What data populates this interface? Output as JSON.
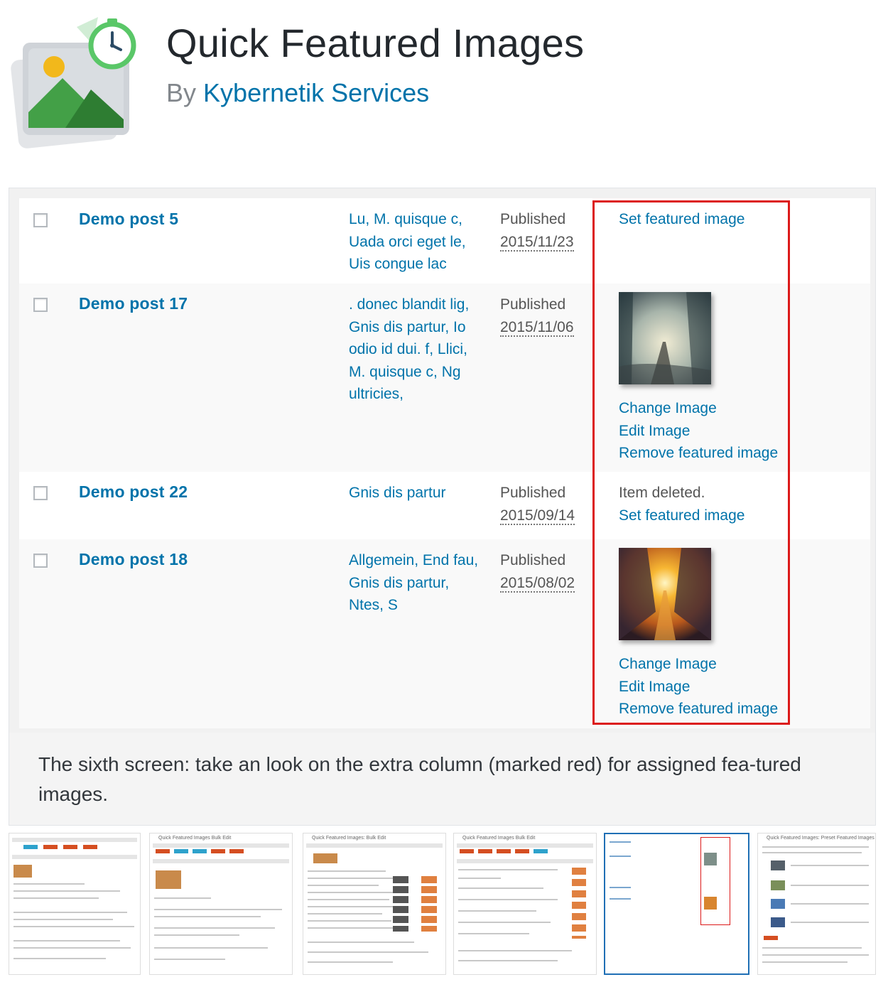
{
  "header": {
    "title": "Quick Featured Images",
    "author_prefix": "By",
    "author_name": "Kybernetik Services"
  },
  "screenshot": {
    "rows": [
      {
        "title": "Demo post 5",
        "categories": [
          "Lu, M. quisque c,",
          "Uada orci eget le,",
          "Uis congue lac"
        ],
        "status": "Published",
        "date": "2015/11/23",
        "image": {
          "has_thumbnail": false,
          "message": "",
          "links": [
            "Set featured image"
          ]
        }
      },
      {
        "title": "Demo post 17",
        "categories": [
          ". donec blandit lig,",
          "Gnis dis partur, Io",
          "odio id dui. f, Llici,",
          "M. quisque c, Ng",
          "ultricies,"
        ],
        "status": "Published",
        "date": "2015/11/06",
        "image": {
          "has_thumbnail": true,
          "thumbnail": "foggy-railway-photo",
          "links": [
            "Change Image",
            "Edit Image",
            "Remove featured image"
          ]
        }
      },
      {
        "title": "Demo post 22",
        "categories": [
          "Gnis dis partur"
        ],
        "status": "Published",
        "date": "2015/09/14",
        "image": {
          "has_thumbnail": false,
          "message": "Item deleted.",
          "links": [
            "Set featured image"
          ]
        }
      },
      {
        "title": "Demo post 18",
        "categories": [
          "Allgemein, End fau,",
          "Gnis dis partur,",
          "Ntes, S"
        ],
        "status": "Published",
        "date": "2015/08/02",
        "image": {
          "has_thumbnail": true,
          "thumbnail": "sunset-street-photo",
          "links": [
            "Change Image",
            "Edit Image",
            "Remove featured image"
          ]
        }
      }
    ],
    "highlight_color": "#dc1a1a",
    "caption": "The sixth screen: take an look on the extra column (marked red) for assigned fea-tured images."
  },
  "thumbnails": {
    "count": 6,
    "active_index": 4,
    "titles": [
      "",
      "Quick Featured Images Bulk Edit",
      "Quick Featured Images: Bulk Edit",
      "Quick Featured Images Bulk Edit",
      "",
      "Quick Featured Images: Preset Featured Images"
    ]
  },
  "colors": {
    "link": "#0073aa",
    "title": "#23282d",
    "muted": "#82878c",
    "active_thumb_border": "#1f6fb5"
  }
}
